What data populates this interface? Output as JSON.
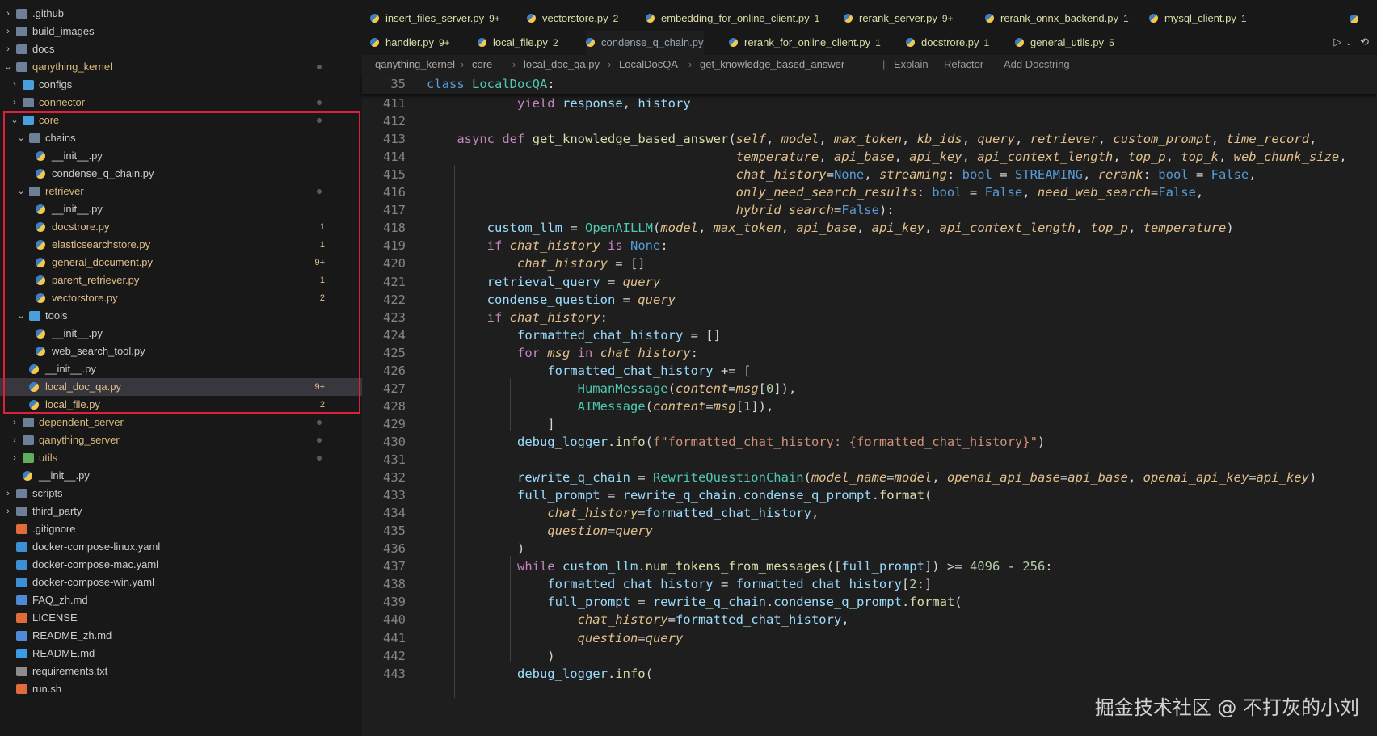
{
  "explorer": {
    "items": [
      {
        "label": ".github",
        "badge": "",
        "dot": false
      },
      {
        "label": "build_images",
        "badge": "",
        "dot": false
      },
      {
        "label": "docs",
        "badge": "",
        "dot": false
      },
      {
        "label": "qanything_kernel",
        "badge": "",
        "dot": true
      },
      {
        "label": "configs",
        "badge": "",
        "dot": false
      },
      {
        "label": "connector",
        "badge": "",
        "dot": true
      },
      {
        "label": "core",
        "badge": "",
        "dot": true
      },
      {
        "label": "chains",
        "badge": "",
        "dot": false
      },
      {
        "label": "__init__.py",
        "badge": "",
        "dot": false
      },
      {
        "label": "condense_q_chain.py",
        "badge": "",
        "dot": false
      },
      {
        "label": "retriever",
        "badge": "",
        "dot": true
      },
      {
        "label": "__init__.py",
        "badge": "",
        "dot": false
      },
      {
        "label": "docstrore.py",
        "badge": "1",
        "dot": false
      },
      {
        "label": "elasticsearchstore.py",
        "badge": "1",
        "dot": false
      },
      {
        "label": "general_document.py",
        "badge": "9+",
        "dot": false
      },
      {
        "label": "parent_retriever.py",
        "badge": "1",
        "dot": false
      },
      {
        "label": "vectorstore.py",
        "badge": "2",
        "dot": false
      },
      {
        "label": "tools",
        "badge": "",
        "dot": false
      },
      {
        "label": "__init__.py",
        "badge": "",
        "dot": false
      },
      {
        "label": "web_search_tool.py",
        "badge": "",
        "dot": false
      },
      {
        "label": "__init__.py",
        "badge": "",
        "dot": false
      },
      {
        "label": "local_doc_qa.py",
        "badge": "9+",
        "dot": false
      },
      {
        "label": "local_file.py",
        "badge": "2",
        "dot": false
      },
      {
        "label": "dependent_server",
        "badge": "",
        "dot": true
      },
      {
        "label": "qanything_server",
        "badge": "",
        "dot": true
      },
      {
        "label": "utils",
        "badge": "",
        "dot": true
      },
      {
        "label": "__init__.py",
        "badge": "",
        "dot": false
      },
      {
        "label": "scripts",
        "badge": "",
        "dot": false
      },
      {
        "label": "third_party",
        "badge": "",
        "dot": false
      },
      {
        "label": ".gitignore",
        "badge": "",
        "dot": false
      },
      {
        "label": "docker-compose-linux.yaml",
        "badge": "",
        "dot": false
      },
      {
        "label": "docker-compose-mac.yaml",
        "badge": "",
        "dot": false
      },
      {
        "label": "docker-compose-win.yaml",
        "badge": "",
        "dot": false
      },
      {
        "label": "FAQ_zh.md",
        "badge": "",
        "dot": false
      },
      {
        "label": "LICENSE",
        "badge": "",
        "dot": false
      },
      {
        "label": "README_zh.md",
        "badge": "",
        "dot": false
      },
      {
        "label": "README.md",
        "badge": "",
        "dot": false
      },
      {
        "label": "requirements.txt",
        "badge": "",
        "dot": false
      },
      {
        "label": "run.sh",
        "badge": "",
        "dot": false
      }
    ]
  },
  "tabs": {
    "row1": [
      {
        "label": "insert_files_server.py",
        "badge": "9+"
      },
      {
        "label": "vectorstore.py",
        "badge": "2"
      },
      {
        "label": "embedding_for_online_client.py",
        "badge": "1"
      },
      {
        "label": "rerank_server.py",
        "badge": "9+"
      },
      {
        "label": "rerank_onnx_backend.py",
        "badge": "1"
      },
      {
        "label": "mysql_client.py",
        "badge": "1"
      }
    ],
    "row2": [
      {
        "label": "handler.py",
        "badge": "9+"
      },
      {
        "label": "local_file.py",
        "badge": "2"
      },
      {
        "label": "condense_q_chain.py",
        "badge": ""
      },
      {
        "label": "rerank_for_online_client.py",
        "badge": "1"
      },
      {
        "label": "docstrore.py",
        "badge": "1"
      },
      {
        "label": "general_utils.py",
        "badge": "5"
      }
    ]
  },
  "breadcrumb": {
    "parts": [
      "qanything_kernel",
      "core",
      "local_doc_qa.py",
      "LocalDocQA",
      "get_knowledge_based_answer"
    ],
    "actions": [
      "Explain",
      "Refactor",
      "Add Docstring"
    ]
  },
  "sticky": {
    "line": "35",
    "code": "class LocalDocQA:"
  },
  "code": {
    "line_numbers": [
      "411",
      "412",
      "413",
      "414",
      "415",
      "416",
      "417",
      "418",
      "419",
      "420",
      "421",
      "422",
      "423",
      "424",
      "425",
      "426",
      "427",
      "428",
      "429",
      "430",
      "431",
      "432",
      "433",
      "434",
      "435",
      "436",
      "437",
      "438",
      "439",
      "440",
      "441",
      "442",
      "443"
    ],
    "lines": [
      "            yield response, history",
      "",
      "    async def get_knowledge_based_answer(self, model, max_token, kb_ids, query, retriever, custom_prompt, time_record,",
      "                                         temperature, api_base, api_key, api_context_length, top_p, top_k, web_chunk_size,",
      "                                         chat_history=None, streaming: bool = STREAMING, rerank: bool = False,",
      "                                         only_need_search_results: bool = False, need_web_search=False,",
      "                                         hybrid_search=False):",
      "        custom_llm = OpenAILLM(model, max_token, api_base, api_key, api_context_length, top_p, temperature)",
      "        if chat_history is None:",
      "            chat_history = []",
      "        retrieval_query = query",
      "        condense_question = query",
      "        if chat_history:",
      "            formatted_chat_history = []",
      "            for msg in chat_history:",
      "                formatted_chat_history += [",
      "                    HumanMessage(content=msg[0]),",
      "                    AIMessage(content=msg[1]),",
      "                ]",
      "            debug_logger.info(f\"formatted_chat_history: {formatted_chat_history}\")",
      "",
      "            rewrite_q_chain = RewriteQuestionChain(model_name=model, openai_api_base=api_base, openai_api_key=api_key)",
      "            full_prompt = rewrite_q_chain.condense_q_prompt.format(",
      "                chat_history=formatted_chat_history,",
      "                question=query",
      "            )",
      "            while custom_llm.num_tokens_from_messages([full_prompt]) >= 4096 - 256:",
      "                formatted_chat_history = formatted_chat_history[2:]",
      "                full_prompt = rewrite_q_chain.condense_q_prompt.format(",
      "                    chat_history=formatted_chat_history,",
      "                    question=query",
      "                )",
      "            debug_logger.info("
    ]
  },
  "watermark": "掘金技术社区 @ 不打灰的小刘",
  "colors": {
    "highlight_border": "#e0203a",
    "selected_row": "#37373d",
    "editor_bg": "#1e1e1e",
    "sidebar_bg": "#181818"
  }
}
